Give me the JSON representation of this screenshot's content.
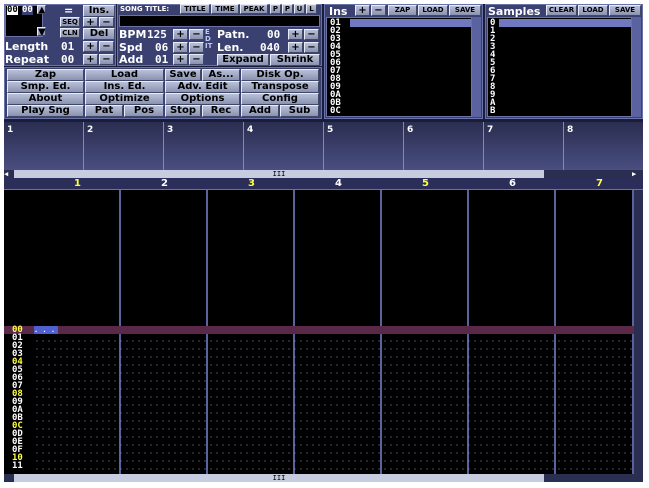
{
  "top_left": {
    "mini_left": "00",
    "mini_right": "00",
    "eq": "=",
    "ins_label": "Ins.",
    "seq_label": "SEQ",
    "cln_label": "CLN",
    "del_label": "Del",
    "plus": "+",
    "minus": "−"
  },
  "song": {
    "title_label": "SONG TITLE:",
    "title_value": "",
    "cols": [
      "TITLE",
      "TIME",
      "PEAK"
    ],
    "mini_btns": [
      "P",
      "P",
      "U",
      "L"
    ]
  },
  "params": {
    "length_label": "Length",
    "length_value": "01",
    "repeat_label": "Repeat",
    "repeat_value": "00",
    "bpm_label": "BPM",
    "bpm_value": "125",
    "spd_label": "Spd",
    "spd_value": "06",
    "add_label": "Add",
    "add_value": "01",
    "patn_label": "Patn.",
    "patn_value": "00",
    "len_label": "Len.",
    "len_value": "040",
    "expand_label": "Expand",
    "shrink_label": "Shrink",
    "vert_label": "EDIT"
  },
  "buttons": [
    [
      "Zap",
      "Load",
      "Save",
      "As...",
      "Disk Op."
    ],
    [
      "Smp. Ed.",
      "Ins. Ed.",
      "Adv. Edit",
      "Transpose"
    ],
    [
      "About",
      "Optimize",
      "Options",
      "Config"
    ],
    [
      "Play Sng",
      "Pat",
      "Pos",
      "Stop",
      "Rec",
      "Add",
      "Sub"
    ]
  ],
  "ins": {
    "label": "Ins",
    "plus": "+",
    "minus": "−",
    "zap": "ZAP",
    "load": "LOAD",
    "save": "SAVE",
    "items": [
      "01",
      "02",
      "03",
      "04",
      "05",
      "06",
      "07",
      "08",
      "09",
      "0A",
      "0B",
      "0C"
    ]
  },
  "samples": {
    "label": "Samples",
    "clear": "CLEAR",
    "load": "LOAD",
    "save": "SAVE",
    "items": [
      "0",
      "1",
      "2",
      "3",
      "4",
      "5",
      "6",
      "7",
      "8",
      "9",
      "A",
      "B"
    ]
  },
  "scopes": [
    "1",
    "2",
    "3",
    "4",
    "5",
    "6",
    "7",
    "8"
  ],
  "scroll_mark": "III",
  "channels": [
    "1",
    "2",
    "3",
    "4",
    "5",
    "6",
    "7"
  ],
  "rows": [
    "00",
    "01",
    "02",
    "03",
    "04",
    "05",
    "06",
    "07",
    "08",
    "09",
    "0A",
    "0B",
    "0C",
    "0D",
    "0E",
    "0F",
    "10",
    "11"
  ],
  "cursor_text": ". . .",
  "colors": {
    "accent": "#ffff40",
    "cursor_row": "#5a2848",
    "bg": "#1a1d3a"
  }
}
